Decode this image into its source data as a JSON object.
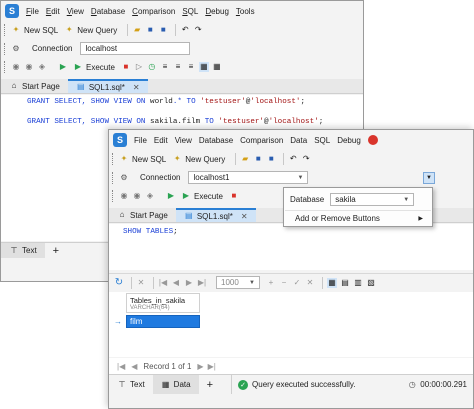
{
  "back": {
    "menu": [
      "File",
      "Edit",
      "View",
      "Database",
      "Comparison",
      "SQL",
      "Debug",
      "Tools"
    ],
    "toolbar1": {
      "new_sql": "New SQL",
      "new_query": "New Query"
    },
    "toolbar2": {
      "connection_label": "Connection",
      "connection_value": "localhost"
    },
    "toolbar3": {
      "execute": "Execute"
    },
    "tabs": {
      "start_page": "Start Page",
      "sql_tab": "SQL1.sql*"
    },
    "code": {
      "line1": {
        "a": "GRANT SELECT, SHOW VIEW ON ",
        "b": "world",
        "c": ".* TO ",
        "d": "'testuser'",
        "e": "@",
        "f": "'localhost'",
        "g": ";"
      },
      "line2": {
        "a": "GRANT SELECT, SHOW VIEW ON ",
        "b": "sakila.film",
        "c": " TO ",
        "d": "'testuser'",
        "e": "@",
        "f": "'localhost'",
        "g": ";"
      }
    },
    "bottom": {
      "text_tab": "Text",
      "add": "+"
    }
  },
  "front": {
    "menu": [
      "File",
      "Edit",
      "View",
      "Database",
      "Comparison",
      "Data",
      "SQL",
      "Debug"
    ],
    "toolbar1": {
      "new_sql": "New SQL",
      "new_query": "New Query"
    },
    "toolbar2": {
      "connection_label": "Connection",
      "connection_value": "localhost1"
    },
    "toolbar3": {
      "execute": "Execute"
    },
    "dropdown": {
      "database_label": "Database",
      "database_value": "sakila",
      "add_remove": "Add or Remove Buttons"
    },
    "tabs": {
      "start_page": "Start Page",
      "sql_tab": "SQL1.sql*"
    },
    "code": {
      "a": "SHOW ",
      "b": "TABLES",
      "c": ";"
    },
    "grid_toolbar": {
      "page_size": "1000"
    },
    "grid": {
      "column": "Tables_in_sakila",
      "type": "VARCHAR(64)",
      "cell": "film"
    },
    "record": "Record 1 of 1",
    "bottom": {
      "text_tab": "Text",
      "data_tab": "Data",
      "add": "+",
      "status": "Query executed successfully.",
      "time": "00:00:00.291"
    }
  },
  "colors": {
    "accent": "#2a7fd4",
    "selection": "#1f7ae0",
    "success": "#2aa352",
    "play": "#2aa352",
    "stop": "#d9342b"
  }
}
